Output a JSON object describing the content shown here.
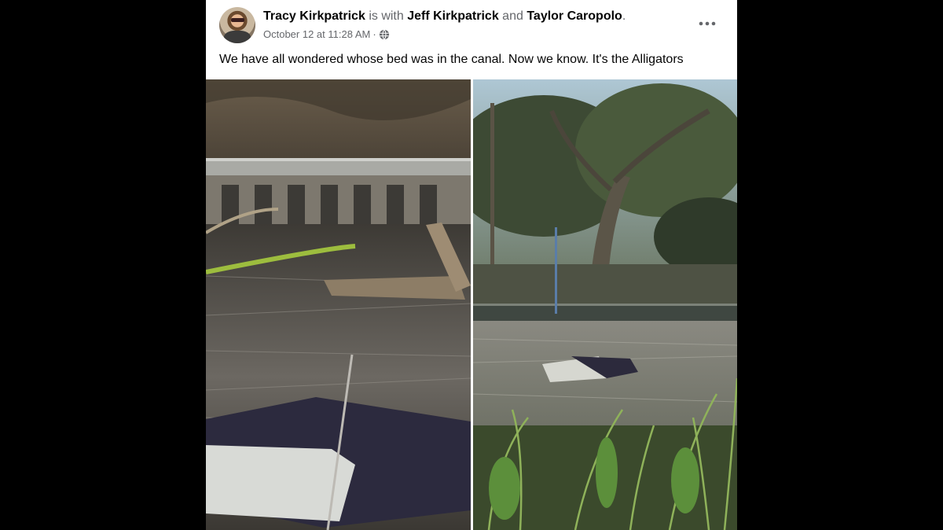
{
  "post": {
    "author": "Tracy Kirkpatrick",
    "with_text": "is with",
    "tagged_1": "Jeff Kirkpatrick",
    "and_text": "and",
    "tagged_2": "Taylor Caropolo",
    "period": ".",
    "timestamp": "October 12 at 11:28 AM",
    "dot": "·",
    "privacy_icon": "globe-icon",
    "more_icon": "more-options-icon",
    "caption": "We have all wondered whose bed was in the canal. Now we know. It's the Alligators"
  },
  "colors": {
    "background": "#000000",
    "card": "#ffffff",
    "name_text": "#050505",
    "secondary_text": "#65676b"
  }
}
